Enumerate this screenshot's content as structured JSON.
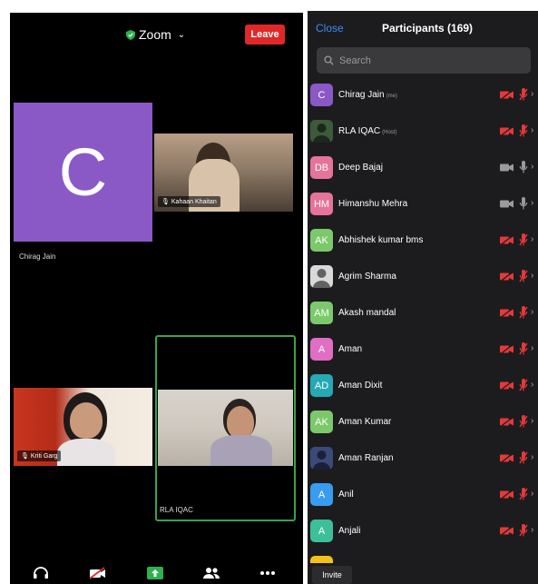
{
  "meeting": {
    "title": "Zoom",
    "leave_label": "Leave",
    "colors": {
      "leave": "#e02828",
      "active_speaker_border": "#3aa34c",
      "shield": "#2bb24c"
    }
  },
  "tiles": {
    "self": {
      "initial": "C",
      "name": "Chirag Jain",
      "color": "#8a59c6"
    },
    "kahaan": {
      "name": "Kahaan Khaitan"
    },
    "kriti": {
      "name": "Kriti Garg"
    },
    "rla": {
      "name": "RLA IQAC"
    }
  },
  "toolbar_icons": [
    "audio-icon",
    "video-off-icon",
    "share-screen-icon",
    "participants-icon",
    "more-icon"
  ],
  "panel": {
    "close_label": "Close",
    "title": "Participants (169)",
    "search_placeholder": "Search",
    "invite_label": "Invite",
    "colors": {
      "close": "#3a8cf1",
      "muted": "#e5383b",
      "unmuted": "#9a9a9e"
    }
  },
  "participants": [
    {
      "initials": "C",
      "name": "Chirag Jain",
      "role": "(me)",
      "color": "#8a59c6",
      "video_on": false,
      "muted": true
    },
    {
      "initials": "",
      "name": "RLA IQAC",
      "role": "(Host)",
      "color": "#3d5a3a",
      "photo": true,
      "video_on": false,
      "muted": true
    },
    {
      "initials": "DB",
      "name": "Deep Bajaj",
      "role": "",
      "color": "#e6739a",
      "video_on": true,
      "muted": false
    },
    {
      "initials": "HM",
      "name": "Himanshu Mehra",
      "role": "",
      "color": "#e6739a",
      "video_on": true,
      "muted": false
    },
    {
      "initials": "AK",
      "name": "Abhishek kumar bms",
      "role": "",
      "color": "#7bc96b",
      "video_on": false,
      "muted": true
    },
    {
      "initials": "",
      "name": "Agrim Sharma",
      "role": "",
      "color": "#d9d9d9",
      "photo": true,
      "video_on": false,
      "muted": true
    },
    {
      "initials": "AM",
      "name": "Akash mandal",
      "role": "",
      "color": "#7bc96b",
      "video_on": false,
      "muted": true
    },
    {
      "initials": "A",
      "name": "Aman",
      "role": "",
      "color": "#e06ec3",
      "video_on": false,
      "muted": true
    },
    {
      "initials": "AD",
      "name": "Aman Dixit",
      "role": "",
      "color": "#27a8b5",
      "video_on": false,
      "muted": true
    },
    {
      "initials": "AK",
      "name": "Aman Kumar",
      "role": "",
      "color": "#7bc96b",
      "video_on": false,
      "muted": true
    },
    {
      "initials": "",
      "name": "Aman Ranjan",
      "role": "",
      "color": "#3b4a7a",
      "photo": true,
      "video_on": false,
      "muted": true
    },
    {
      "initials": "A",
      "name": "Anil",
      "role": "",
      "color": "#3a9cf0",
      "video_on": false,
      "muted": true
    },
    {
      "initials": "A",
      "name": "Anjali",
      "role": "",
      "color": "#3dbf9a",
      "video_on": false,
      "muted": true
    }
  ]
}
